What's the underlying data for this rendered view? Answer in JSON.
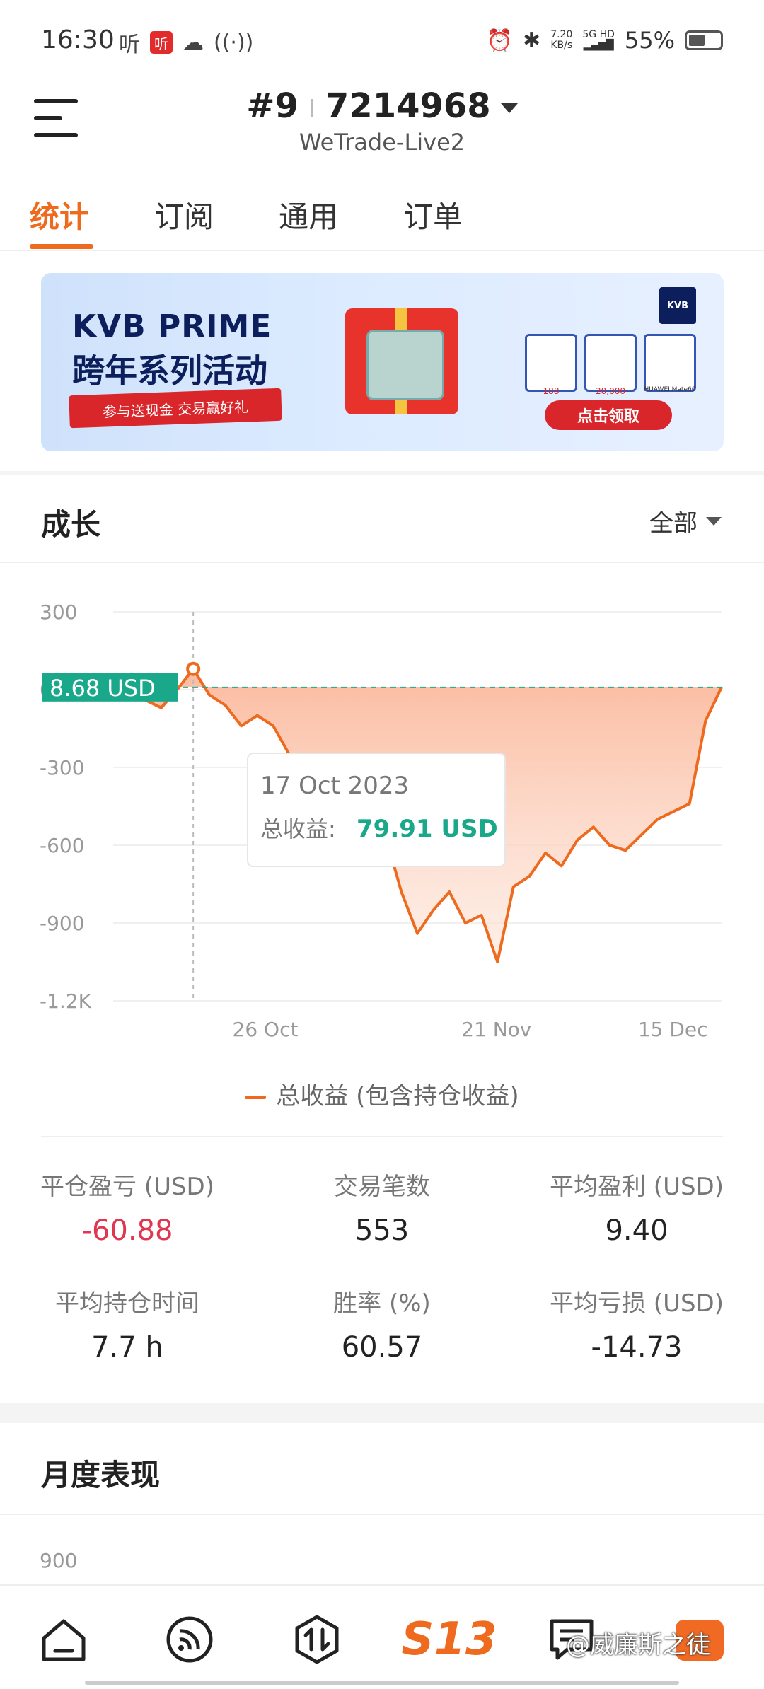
{
  "status_bar": {
    "time": "16:30",
    "listen_icon_text": "听",
    "net_speed_top": "7.20",
    "net_speed_bottom": "KB/s",
    "signal_top": "5G HD",
    "battery": "55%"
  },
  "header": {
    "account_prefix": "#9",
    "account_number": "7214968",
    "server": "WeTrade-Live2"
  },
  "tabs": [
    "统计",
    "订阅",
    "通用",
    "订单"
  ],
  "banner": {
    "title1": "KVB PRIME",
    "title2": "跨年系列活动",
    "ribbon": "参与送现金 交易赢好礼",
    "logo": "KVB",
    "prize1": "188",
    "prize2": "20,000",
    "prize3": "HUAWEI Mate60",
    "cta": "点击领取"
  },
  "growth": {
    "title": "成长",
    "range": "全部"
  },
  "chart_data": {
    "type": "area",
    "title": "",
    "y_ticks": [
      "300",
      "0",
      "-300",
      "-600",
      "-900",
      "-1.2K"
    ],
    "ylim": [
      -1200,
      300
    ],
    "x_ticks": [
      "26 Oct",
      "21 Nov",
      "15 Dec"
    ],
    "current_value_label": "8.68 USD",
    "tooltip": {
      "date": "17 Oct 2023",
      "label": "总收益:",
      "value": "79.91 USD"
    },
    "series": [
      {
        "name": "总收益 (包含持仓收益)",
        "values": [
          0,
          -5,
          -40,
          -70,
          0,
          79.91,
          -20,
          -60,
          -140,
          -100,
          -140,
          -250,
          -300,
          -330,
          -360,
          -400,
          -430,
          -560,
          -780,
          -940,
          -850,
          -780,
          -900,
          -870,
          -1050,
          -760,
          -720,
          -630,
          -680,
          -580,
          -530,
          -600,
          -620,
          -560,
          -500,
          -470,
          -440,
          -120,
          8.68
        ]
      }
    ],
    "colors": {
      "line": "#ee6a1e",
      "fill_top": "#fbb79a",
      "current_line": "#1aa88a"
    }
  },
  "stats": [
    {
      "label": "平仓盈亏 (USD)",
      "value": "-60.88",
      "negative": true
    },
    {
      "label": "交易笔数",
      "value": "553",
      "negative": false
    },
    {
      "label": "平均盈利 (USD)",
      "value": "9.40",
      "negative": false
    },
    {
      "label": "平均持仓时间",
      "value": "7.7 h",
      "negative": false
    },
    {
      "label": "胜率 (%)",
      "value": "60.57",
      "negative": false
    },
    {
      "label": "平均亏损 (USD)",
      "value": "-14.73",
      "negative": false
    }
  ],
  "monthly": {
    "title": "月度表现",
    "first_tick": "900"
  },
  "bottom_nav": {
    "center_label": "S13",
    "watermark": "@威廉斯之徒"
  }
}
